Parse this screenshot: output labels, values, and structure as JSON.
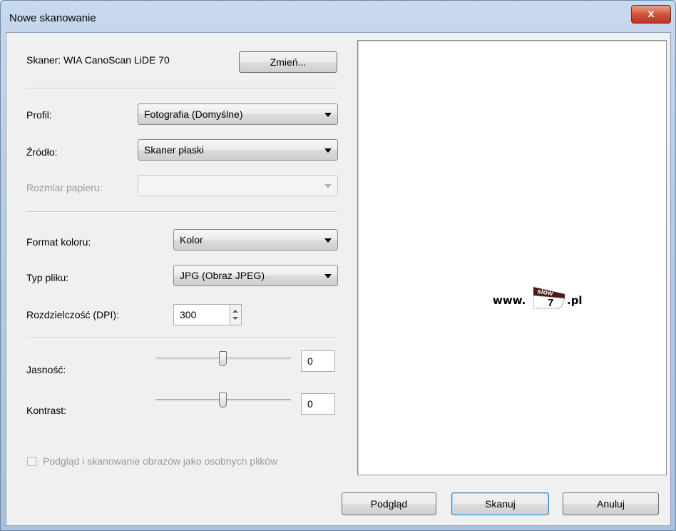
{
  "window": {
    "title": "Nowe skanowanie",
    "close_label": "x"
  },
  "scanner": {
    "label": "Skaner: WIA CanoScan LiDE 70",
    "change_button": "Zmień..."
  },
  "profile": {
    "label": "Profil:",
    "value": "Fotografia (Domyślne)"
  },
  "source": {
    "label": "Źródło:",
    "value": "Skaner płaski"
  },
  "paper_size": {
    "label": "Rozmiar papieru:",
    "value": ""
  },
  "color_format": {
    "label": "Format koloru:",
    "value": "Kolor"
  },
  "file_type": {
    "label": "Typ pliku:",
    "value": "JPG (Obraz JPEG)"
  },
  "resolution": {
    "label": "Rozdzielczość (DPI):",
    "value": "300"
  },
  "brightness": {
    "label": "Jasność:",
    "value": "0",
    "level": 0.5
  },
  "contrast": {
    "label": "Kontrast:",
    "value": "0",
    "level": 0.5
  },
  "separate_files": {
    "label": "Podgląd i skanowanie obrazów jako osobnych plików",
    "checked": false
  },
  "preview": {
    "logo_prefix": "www.",
    "logo_badge_top": "slow",
    "logo_badge_num": "7",
    "logo_suffix": ".pl",
    "badge_color": "#4a1c14"
  },
  "buttons": {
    "preview": "Podgląd",
    "scan": "Skanuj",
    "cancel": "Anuluj"
  }
}
